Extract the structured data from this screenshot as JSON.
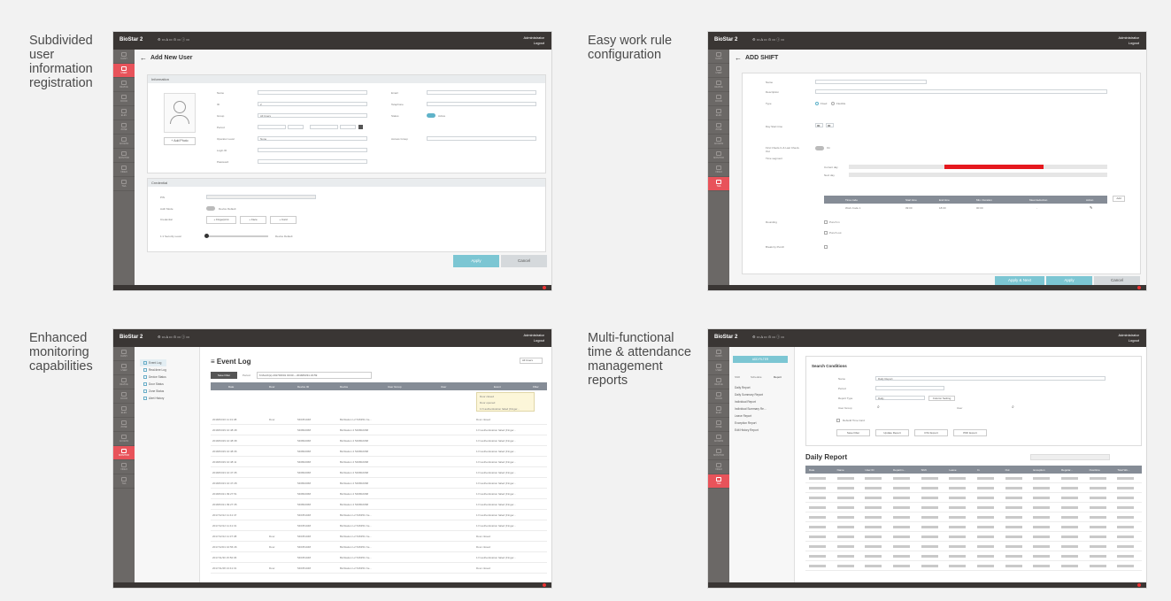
{
  "features": [
    {
      "label": "Subdivided user information registration"
    },
    {
      "label": "Easy work rule configuration"
    },
    {
      "label": "Enhanced monitoring capabilities"
    },
    {
      "label": "Multi-functional time & attendance management reports"
    }
  ],
  "app": {
    "logo": "BioStar 2",
    "admin_name": "Administrator",
    "logout": "Logout"
  },
  "screens": {
    "add_user": {
      "title": "Add New User",
      "info_header": "Information",
      "credential_header": "Credential",
      "add_photo": "+ Add Photo",
      "apply": "Apply",
      "cancel": "Cancel",
      "fields_left": [
        "Name",
        "ID",
        "Group",
        "Period",
        "Operator Level",
        "Login ID",
        "Password"
      ],
      "fields_right": [
        "Email",
        "Telephone",
        "Status",
        "Access Group"
      ],
      "id_value": "2",
      "group_value": "All Users",
      "status_value": "Active",
      "operator_value": "None",
      "cred_fields": [
        "PIN",
        "Auth Mode",
        "Credential",
        "1:1 Security Level"
      ],
      "auth_value": "Device Default",
      "cred_buttons": [
        "+ Fingerprint",
        "+ Face",
        "+ Card"
      ],
      "security_value": "Device Default"
    },
    "add_shift": {
      "title": "ADD SHIFT",
      "fields": [
        "Name",
        "Description",
        "Type",
        "Day Start time",
        "First Check-In & Last Check-Out",
        "Time segment",
        "Rounding",
        "Break by Punch"
      ],
      "type_options": [
        "Fixed",
        "Flexible"
      ],
      "day_start_hour": "00",
      "day_start_minute": "00",
      "toggle_value": "On",
      "seg_rows": [
        "Current day",
        "Next day"
      ],
      "seg_cols": [
        "Time code",
        "Start time",
        "End time",
        "Min. Duration",
        "Meal deduction",
        "Action"
      ],
      "seg_row": [
        "Work Code 1",
        "09:00",
        "18:00",
        "00:00",
        "-"
      ],
      "add_btn": "Add",
      "rounding_opts": [
        "Punch in",
        "Punch out"
      ],
      "apply_next": "Apply & Next",
      "apply": "Apply",
      "cancel": "Cancel"
    },
    "monitoring": {
      "title": "Event Log",
      "menu": [
        "Event Log",
        "Real-time Log",
        "Device Status",
        "Door Status",
        "Zone Status",
        "Alert History"
      ],
      "filter_btn": "Save Filter",
      "period_label": "Period",
      "period_value": "6 Month(s) 2017/06/01 00:00 ~ 2018/03/31 23:59",
      "view_label": "All Users",
      "col_headers": [
        "Date",
        "Door",
        "Device ID",
        "Device",
        "User Group",
        "User",
        "Event",
        "Filter"
      ],
      "event_filters": [
        "Door closed",
        "Door opened",
        "1:N authentication failed (Finger..."
      ],
      "rows": [
        {
          "date": "2018/03/16 11:31:38",
          "door": "Door",
          "device": "546351048",
          "name": "BioStation L2 546351 Ne...",
          "event": "Door closed"
        },
        {
          "date": "2018/03/29 10:48:48",
          "door": "",
          "device": "546802068",
          "name": "BioStation 2 546802068",
          "event": "1:N authentication failed (Finger..."
        },
        {
          "date": "2018/03/29 10:48:38",
          "door": "",
          "device": "546802068",
          "name": "BioStation 2 546802068",
          "event": "1:N authentication failed (Finger..."
        },
        {
          "date": "2018/03/29 10:48:36",
          "door": "",
          "device": "546802068",
          "name": "BioStation 2 546802068",
          "event": "1:N authentication failed (Finger..."
        },
        {
          "date": "2018/03/29 10:48:11",
          "door": "",
          "device": "546802068",
          "name": "BioStation 2 546802068",
          "event": "1:N authentication failed (Finger..."
        },
        {
          "date": "2018/03/23 10:47:35",
          "door": "",
          "device": "546802068",
          "name": "BioStation 2 546802068",
          "event": "1:N authentication failed (Finger..."
        },
        {
          "date": "2018/03/23 10:47:28",
          "door": "",
          "device": "546802068",
          "name": "BioStation 2 546802068",
          "event": "1:N authentication failed (Finger..."
        },
        {
          "date": "2018/03/21 09:27:51",
          "door": "",
          "device": "546802068",
          "name": "BioStation 2 546802068",
          "event": "1:N authentication failed (Finger..."
        },
        {
          "date": "2018/03/21 09:27:35",
          "door": "",
          "device": "546802068",
          "name": "BioStation 2 546802068",
          "event": "1:N authentication failed (Finger..."
        },
        {
          "date": "2017/12/12 11:41:47",
          "door": "",
          "device": "546351048",
          "name": "BioStation L2 546351 Ne...",
          "event": "1:N authentication failed (Finger..."
        },
        {
          "date": "2017/12/12 11:41:31",
          "door": "",
          "device": "546351048",
          "name": "BioStation L2 546351 Ne...",
          "event": "1:N authentication failed (Finger..."
        },
        {
          "date": "2017/12/12 11:37:38",
          "door": "Door",
          "device": "546351048",
          "name": "BioStation L2 546351 Ne...",
          "event": "Door closed"
        },
        {
          "date": "2017/12/01 10:56:46",
          "door": "Door",
          "device": "546351048",
          "name": "BioStation L2 546351 Ne...",
          "event": "Door closed"
        },
        {
          "date": "2017/11/30 15:50:36",
          "door": "",
          "device": "546351048",
          "name": "BioStation L2 546351 Ne...",
          "event": "1:N authentication failed (Finger..."
        },
        {
          "date": "2017/11/28 13:41:31",
          "door": "Door",
          "device": "546351048",
          "name": "BioStation L2 546351 Ne...",
          "event": "Door closed"
        }
      ]
    },
    "reports": {
      "add_btn": "ADD FILTER",
      "tabs": [
        "Shift",
        "Schedule",
        "Report"
      ],
      "report_list": [
        "Daily Report",
        "Daily Summary Report",
        "Individual Report",
        "Individual Summary Re...",
        "Leave Report",
        "Exception Report",
        "Edit History Report"
      ],
      "search_title": "Search Conditions",
      "search_fields": [
        "Name",
        "Period",
        "Report Type",
        "User Group",
        "User"
      ],
      "name_value": "Daily Report",
      "report_type_value": "Daily",
      "column_setting": "Column Setting",
      "rebuild": "Rebuild Time Card",
      "action_btns": [
        "Save Filter",
        "Update Report",
        "CSV Export",
        "PDF Export"
      ],
      "table_title": "Daily Report",
      "columns": [
        "Date",
        "Name",
        "User ID",
        "Departm...",
        "Shift",
        "Leave",
        "In",
        "Out",
        "Exception",
        "Regular...",
        "Overtime",
        "Total Wo..."
      ]
    }
  }
}
